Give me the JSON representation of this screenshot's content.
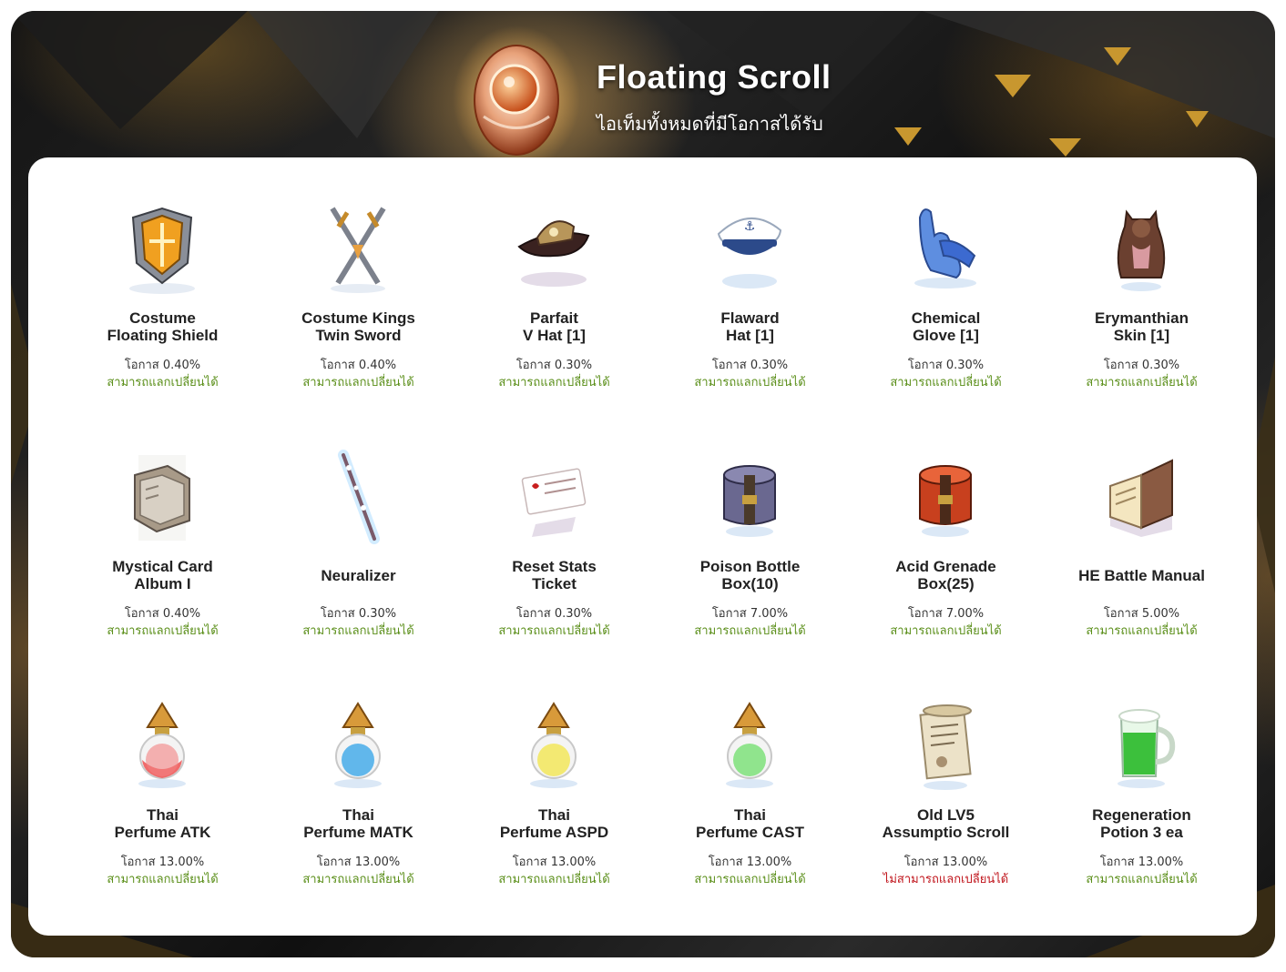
{
  "header": {
    "title": "Floating Scroll",
    "subtitle": "ไอเท็มทั้งหมดที่มีโอกาสได้รับ",
    "icon": "floating-scroll-egg-icon"
  },
  "colors": {
    "exchangeable": "#5b8f1a",
    "not_exchangeable": "#c0141b",
    "accent": "#d4a24a"
  },
  "items": [
    {
      "name": "Costume\nFloating Shield",
      "chance": "โอกาส 0.40%",
      "exchange": "สามารถแลกเปลี่ยนได้",
      "exchangeable": true,
      "icon": "shield-icon"
    },
    {
      "name": "Costume Kings\nTwin Sword",
      "chance": "โอกาส 0.40%",
      "exchange": "สามารถแลกเปลี่ยนได้",
      "exchangeable": true,
      "icon": "twin-sword-icon"
    },
    {
      "name": "Parfait\nV Hat [1]",
      "chance": "โอกาส 0.30%",
      "exchange": "สามารถแลกเปลี่ยนได้",
      "exchangeable": true,
      "icon": "hat-icon"
    },
    {
      "name": "Flaward\nHat [1]",
      "chance": "โอกาส 0.30%",
      "exchange": "สามารถแลกเปลี่ยนได้",
      "exchangeable": true,
      "icon": "sailor-hat-icon"
    },
    {
      "name": "Chemical\nGlove [1]",
      "chance": "โอกาส 0.30%",
      "exchange": "สามารถแลกเปลี่ยนได้",
      "exchangeable": true,
      "icon": "glove-icon"
    },
    {
      "name": "Erymanthian\nSkin [1]",
      "chance": "โอกาส 0.30%",
      "exchange": "สามารถแลกเปลี่ยนได้",
      "exchangeable": true,
      "icon": "cloak-icon"
    },
    {
      "name": "Mystical Card\nAlbum I",
      "chance": "โอกาส 0.40%",
      "exchange": "สามารถแลกเปลี่ยนได้",
      "exchangeable": true,
      "icon": "book-icon"
    },
    {
      "name": "Neuralizer",
      "chance": "โอกาส 0.30%",
      "exchange": "สามารถแลกเปลี่ยนได้",
      "exchangeable": true,
      "icon": "wand-icon"
    },
    {
      "name": "Reset Stats\nTicket",
      "chance": "โอกาส 0.30%",
      "exchange": "สามารถแลกเปลี่ยนได้",
      "exchangeable": true,
      "icon": "ticket-icon"
    },
    {
      "name": "Poison Bottle\nBox(10)",
      "chance": "โอกาส 7.00%",
      "exchange": "สามารถแลกเปลี่ยนได้",
      "exchangeable": true,
      "icon": "purple-box-icon"
    },
    {
      "name": "Acid Grenade\nBox(25)",
      "chance": "โอกาส 7.00%",
      "exchange": "สามารถแลกเปลี่ยนได้",
      "exchangeable": true,
      "icon": "red-box-icon"
    },
    {
      "name": "HE Battle Manual",
      "chance": "โอกาส 5.00%",
      "exchange": "สามารถแลกเปลี่ยนได้",
      "exchangeable": true,
      "icon": "manual-icon"
    },
    {
      "name": "Thai\nPerfume ATK",
      "chance": "โอกาส 13.00%",
      "exchange": "สามารถแลกเปลี่ยนได้",
      "exchangeable": true,
      "icon": "perfume-red-icon"
    },
    {
      "name": "Thai\nPerfume MATK",
      "chance": "โอกาส 13.00%",
      "exchange": "สามารถแลกเปลี่ยนได้",
      "exchangeable": true,
      "icon": "perfume-blue-icon"
    },
    {
      "name": "Thai\nPerfume ASPD",
      "chance": "โอกาส 13.00%",
      "exchange": "สามารถแลกเปลี่ยนได้",
      "exchangeable": true,
      "icon": "perfume-yellow-icon"
    },
    {
      "name": "Thai\nPerfume CAST",
      "chance": "โอกาส 13.00%",
      "exchange": "สามารถแลกเปลี่ยนได้",
      "exchangeable": true,
      "icon": "perfume-green-icon"
    },
    {
      "name": "Old LV5\nAssumptio Scroll",
      "chance": "โอกาส 13.00%",
      "exchange": "ไม่สามารถแลกเปลี่ยนได้",
      "exchangeable": false,
      "icon": "scroll-icon"
    },
    {
      "name": "Regeneration\nPotion 3 ea",
      "chance": "โอกาส 13.00%",
      "exchange": "สามารถแลกเปลี่ยนได้",
      "exchangeable": true,
      "icon": "mug-icon"
    }
  ]
}
